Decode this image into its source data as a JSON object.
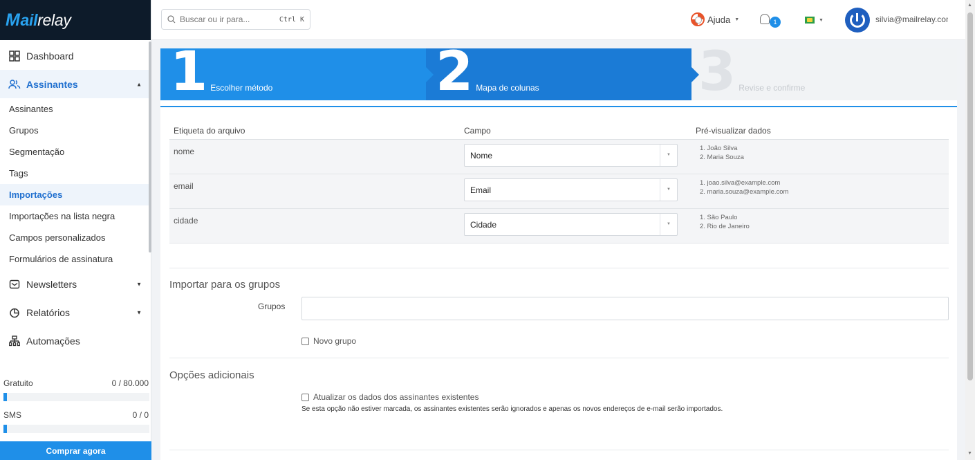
{
  "brand": {
    "logo_m": "M",
    "logo_ail": "ail",
    "logo_relay": "relay"
  },
  "topbar": {
    "search_placeholder": "Buscar ou ir para...",
    "search_shortcut": "Ctrl K",
    "help_label": "Ajuda",
    "notifications_count": "1",
    "user_email": "silvia@mailrelay.com"
  },
  "sidebar": {
    "dashboard": "Dashboard",
    "subscribers": "Assinantes",
    "sub_items": [
      "Assinantes",
      "Grupos",
      "Segmentação",
      "Tags",
      "Importações",
      "Importações na lista negra",
      "Campos personalizados",
      "Formulários de assinatura"
    ],
    "newsletters": "Newsletters",
    "reports": "Relatórios",
    "automations": "Automações",
    "plan_label": "Gratuito",
    "plan_usage": "0 / 80.000",
    "sms_label": "SMS",
    "sms_usage": "0 / 0",
    "buy_button": "Comprar agora"
  },
  "steps": [
    {
      "number": "1",
      "label": "Escolher método"
    },
    {
      "number": "2",
      "label": "Mapa de colunas"
    },
    {
      "number": "3",
      "label": "Revise e confirme"
    }
  ],
  "mapping": {
    "headers": [
      "Etiqueta do arquivo",
      "Campo",
      "Pré-visualizar dados"
    ],
    "rows": [
      {
        "label": "nome",
        "field": "Nome",
        "preview1": "1. João Silva",
        "preview2": "2. Maria Souza"
      },
      {
        "label": "email",
        "field": "Email",
        "preview1": "1. joao.silva@example.com",
        "preview2": "2. maria.souza@example.com"
      },
      {
        "label": "cidade",
        "field": "Cidade",
        "preview1": "1. São Paulo",
        "preview2": "2. Rio de Janeiro"
      }
    ]
  },
  "import_groups": {
    "title": "Importar para os grupos",
    "groups_label": "Grupos",
    "new_group_label": "Novo grupo"
  },
  "options": {
    "title": "Opções adicionais",
    "update_label": "Atualizar os dados dos assinantes existentes",
    "help_text": "Se esta opção não estiver marcada, os assinantes existentes serão ignorados e apenas os novos endereços de e-mail serão importados."
  },
  "colors": {
    "accent": "#1f8fe8",
    "step2": "#1b7bd6",
    "logo_bg": "#0d1b2a"
  }
}
